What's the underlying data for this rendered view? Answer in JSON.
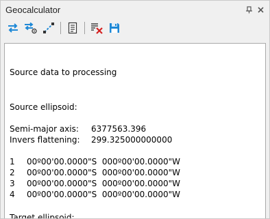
{
  "window": {
    "title": "Geocalculator",
    "pin_glyph": "⊐",
    "close_glyph": "✕"
  },
  "toolbar": {
    "icons": [
      "swap-arrows-icon",
      "swap-settings-icon",
      "measure-line-icon",
      "document-icon",
      "clear-list-icon",
      "save-icon"
    ]
  },
  "output": {
    "heading": "Source data to processing",
    "source_label": "Source ellipsoid:",
    "semi_major_label": "Semi-major axis:",
    "semi_major_value": "6377563.396",
    "inv_flat_label": "Invers flattening:",
    "inv_flat_value": "299.325000000000",
    "points": [
      {
        "n": "1",
        "coord": "00º00'00.0000\"S  000º00'00.0000\"W"
      },
      {
        "n": "2",
        "coord": "00º00'00.0000\"S  000º00'00.0000\"W"
      },
      {
        "n": "3",
        "coord": "00º00'00.0000\"S  000º00'00.0000\"W"
      },
      {
        "n": "4",
        "coord": "00º00'00.0000\"S  000º00'00.0000\"W"
      }
    ],
    "target_label": "Target ellipsoid:"
  },
  "colors": {
    "accent_blue": "#1e88d6",
    "clear_red": "#d42020"
  }
}
